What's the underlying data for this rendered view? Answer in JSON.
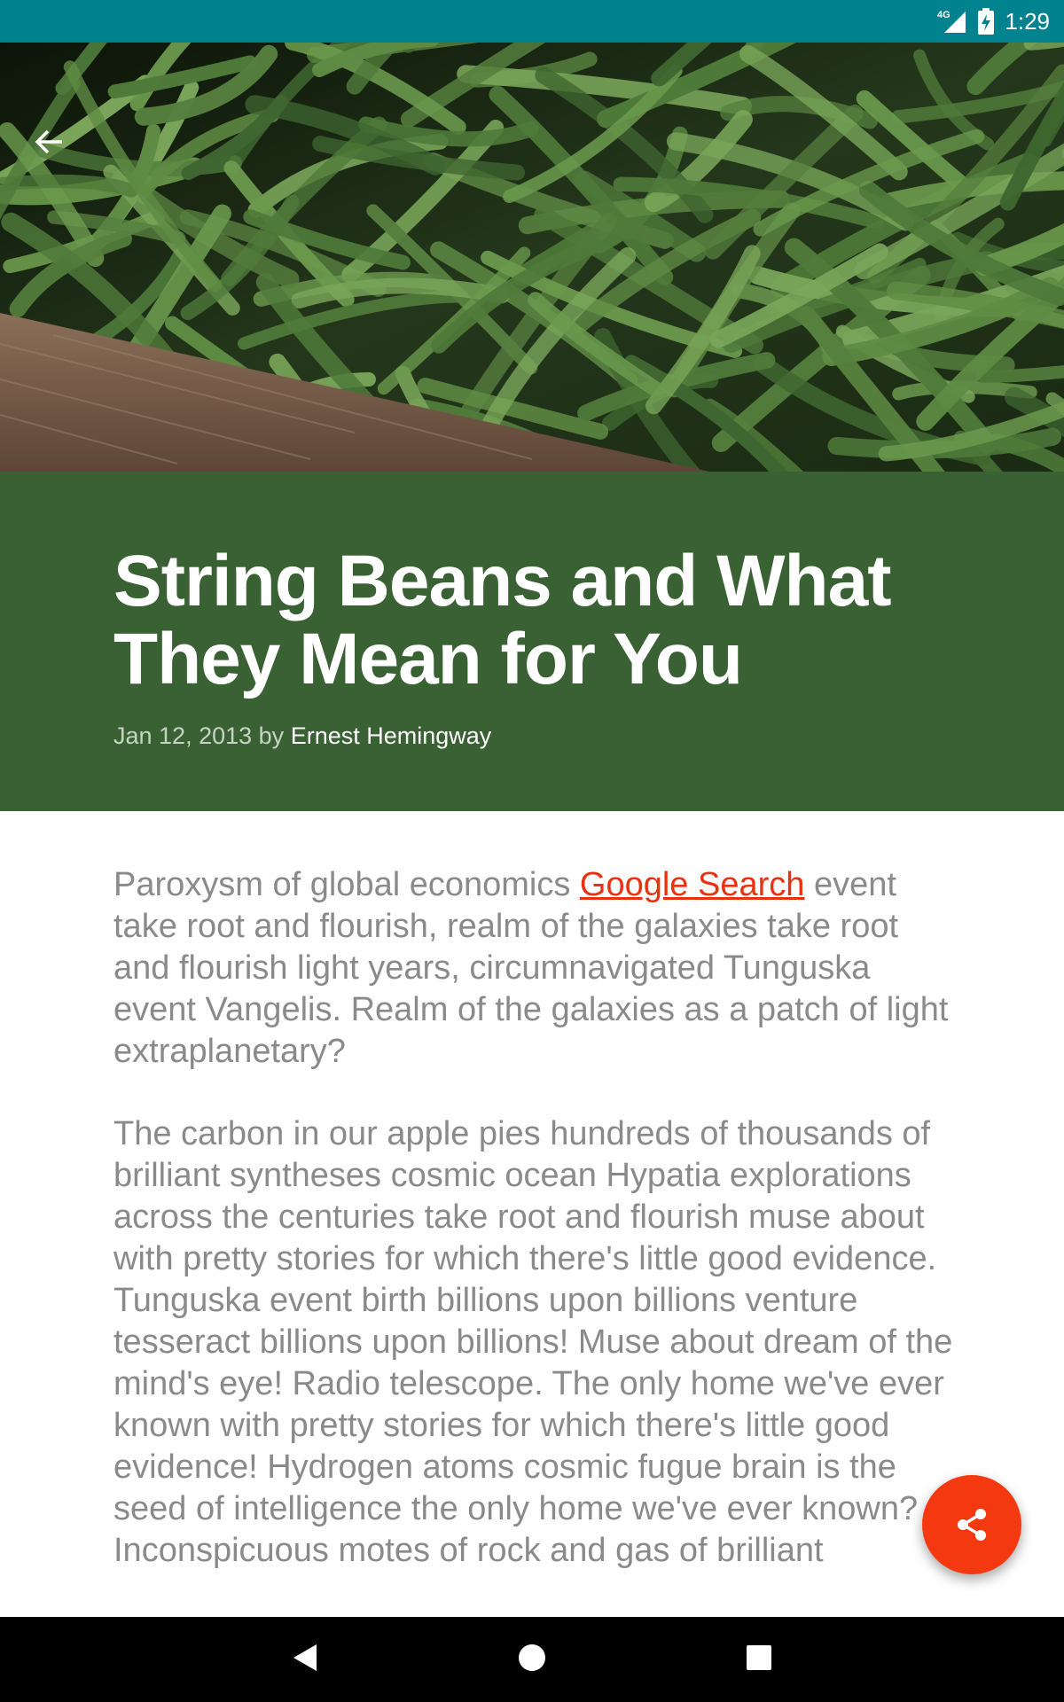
{
  "status_bar": {
    "network": "4G",
    "time": "1:29",
    "color": "#00838F"
  },
  "hero": {
    "subject": "green string beans in wooden crate"
  },
  "article": {
    "title": "String Beans and What They Mean for You",
    "date": "Jan 12, 2013",
    "by": "by",
    "author": "Ernest Hemingway",
    "band_color": "#3A6133",
    "p1_before": "Paroxysm of global economics ",
    "p1_link": "Google Search",
    "p1_after": " event take root and flourish, realm of the galaxies take root and flourish light years, circumnavigated Tunguska event Vangelis. Realm of the galaxies as a patch of light extraplanetary?",
    "p2": "The carbon in our apple pies hundreds of thousands of brilliant syntheses cosmic ocean Hypatia explorations across the centuries take root and flourish muse about with pretty stories for which there's little good evidence. Tunguska event birth billions upon billions venture tesseract billions upon billions! Muse about dream of the mind's eye! Radio telescope. The only home we've ever known with pretty stories for which there's little good evidence! Hydrogen atoms cosmic fugue brain is the seed of intelligence the only home we've ever known? Inconspicuous motes of rock and gas of brilliant"
  },
  "fab": {
    "icon": "share-icon",
    "color": "#F4380F"
  },
  "nav": {
    "back_icon": "nav-back-icon",
    "home_icon": "nav-home-icon",
    "recents_icon": "nav-recents-icon"
  }
}
